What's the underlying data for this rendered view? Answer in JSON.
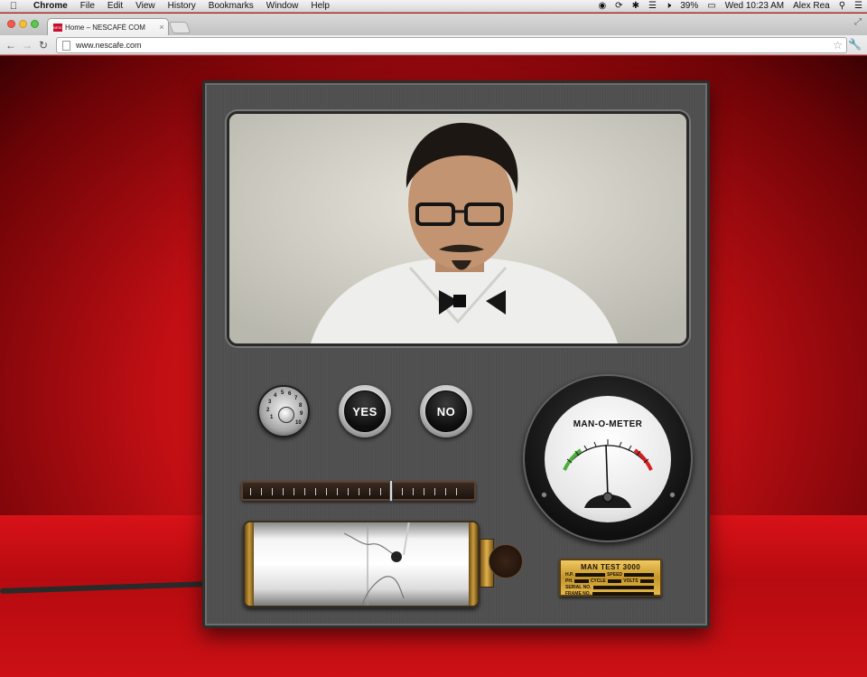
{
  "menubar": {
    "app": "Chrome",
    "items": [
      "File",
      "Edit",
      "View",
      "History",
      "Bookmarks",
      "Window",
      "Help"
    ],
    "battery": "39%",
    "clock": "Wed 10:23 AM",
    "user": "Alex Rea"
  },
  "browser": {
    "tab_title": "Home – NESCAFÉ COM",
    "favicon_text": "NESCAFE",
    "url": "www.nescafe.com"
  },
  "console": {
    "yes_label": "YES",
    "no_label": "NO",
    "dial_numbers": [
      "1",
      "2",
      "3",
      "4",
      "5",
      "6",
      "7",
      "8",
      "9",
      "10"
    ],
    "meter_label": "MAN-O-METER",
    "plate": {
      "title": "MAN TEST 3000",
      "hp": "H.P.",
      "speed": "SPEED",
      "ph": "PH.",
      "cycle": "CYCLE",
      "volts": "VOLTS",
      "serial": "SERIAL NO.",
      "frame": "FRAME NO."
    }
  },
  "colors": {
    "background_red": "#c40d12",
    "console_steel": "#4f4f4f",
    "brass": "#d3a53f"
  }
}
